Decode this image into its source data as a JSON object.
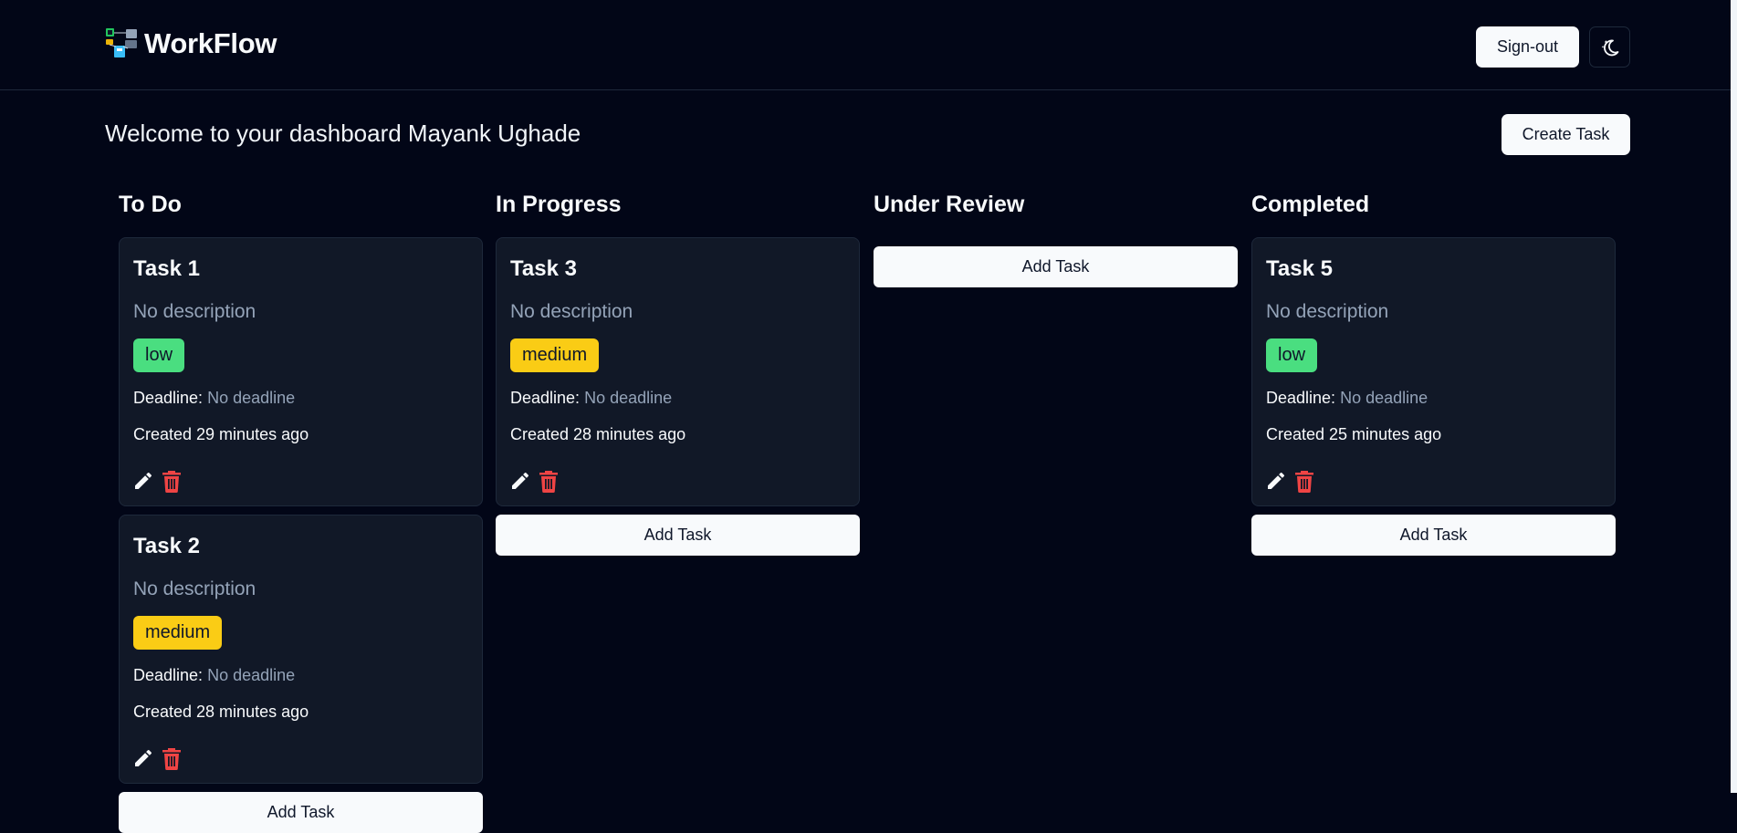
{
  "header": {
    "app_name": "WorkFlow",
    "signout_label": "Sign-out",
    "theme_icon": "moon-stars-icon"
  },
  "dashboard": {
    "welcome": "Welcome to your dashboard Mayank Ughade",
    "create_label": "Create Task"
  },
  "add_task_label": "Add Task",
  "deadline_label": "Deadline:",
  "columns": [
    {
      "title": "To Do",
      "cards": [
        {
          "title": "Task 1",
          "description": "No description",
          "priority": "low",
          "deadline": "No deadline",
          "created": "Created 29 minutes ago"
        },
        {
          "title": "Task 2",
          "description": "No description",
          "priority": "medium",
          "deadline": "No deadline",
          "created": "Created 28 minutes ago"
        }
      ]
    },
    {
      "title": "In Progress",
      "cards": [
        {
          "title": "Task 3",
          "description": "No description",
          "priority": "medium",
          "deadline": "No deadline",
          "created": "Created 28 minutes ago"
        }
      ]
    },
    {
      "title": "Under Review",
      "cards": []
    },
    {
      "title": "Completed",
      "cards": [
        {
          "title": "Task 5",
          "description": "No description",
          "priority": "low",
          "deadline": "No deadline",
          "created": "Created 25 minutes ago"
        }
      ]
    }
  ],
  "colors": {
    "background": "#020617",
    "card": "#111827",
    "low": "#4ade80",
    "medium": "#facc15",
    "delete": "#ef4444"
  }
}
